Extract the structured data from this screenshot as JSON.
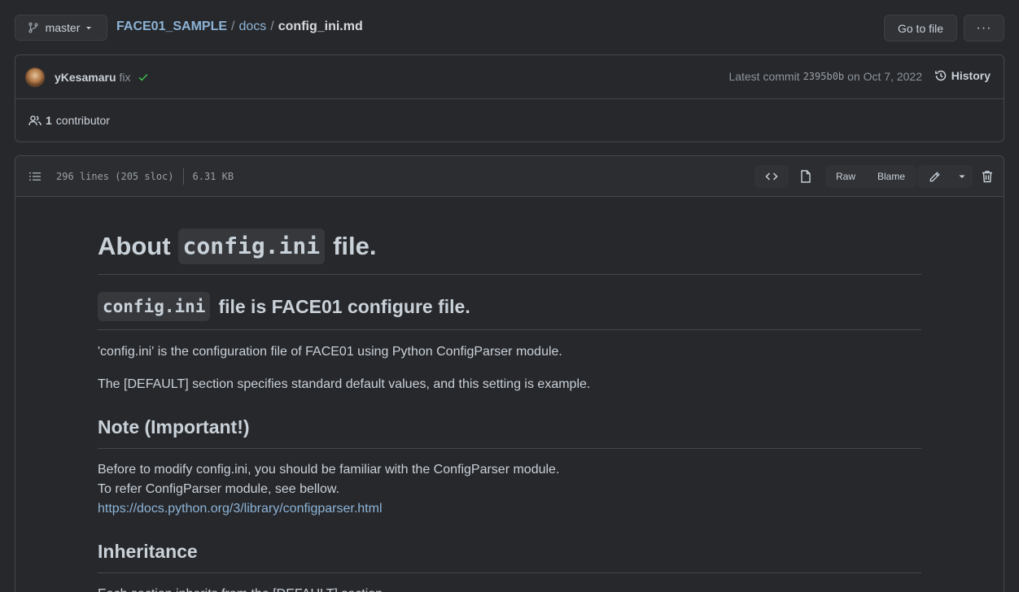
{
  "top": {
    "branch": "master",
    "repo": "FACE01_SAMPLE",
    "sep": "/",
    "dir": "docs",
    "file": "config_ini.md",
    "goto_label": "Go to file",
    "more_label": "···"
  },
  "commit": {
    "author": "yKesamaru",
    "message": "fix",
    "latest_label": "Latest commit",
    "sha": "2395b0b",
    "date": "on Oct 7, 2022",
    "history_label": "History",
    "contributors_count": "1",
    "contributors_label": "contributor"
  },
  "file": {
    "lines": "296 lines (205 sloc)",
    "size": "6.31 KB",
    "raw_label": "Raw",
    "blame_label": "Blame"
  },
  "doc": {
    "h1_pre": "About",
    "h1_code": "config.ini",
    "h1_post": "file.",
    "h2a_code": "config.ini",
    "h2a_post": "file is FACE01 configure file.",
    "p1": "'config.ini' is the configuration file of FACE01 using Python ConfigParser module.",
    "p2": "The [DEFAULT] section specifies standard default values, and this setting is example.",
    "h2b": "Note (Important!)",
    "p3_line1": "Before to modify config.ini, you should be familiar with the ConfigParser module.",
    "p3_line2": "To refer ConfigParser module, see bellow.",
    "p3_link": "https://docs.python.org/3/library/configparser.html",
    "h2c": "Inheritance",
    "p4": "Each section inherits from the [DEFAULT] section."
  },
  "colors": {
    "background": "#27282b",
    "link": "#8db4d8",
    "success": "#3fb950"
  }
}
